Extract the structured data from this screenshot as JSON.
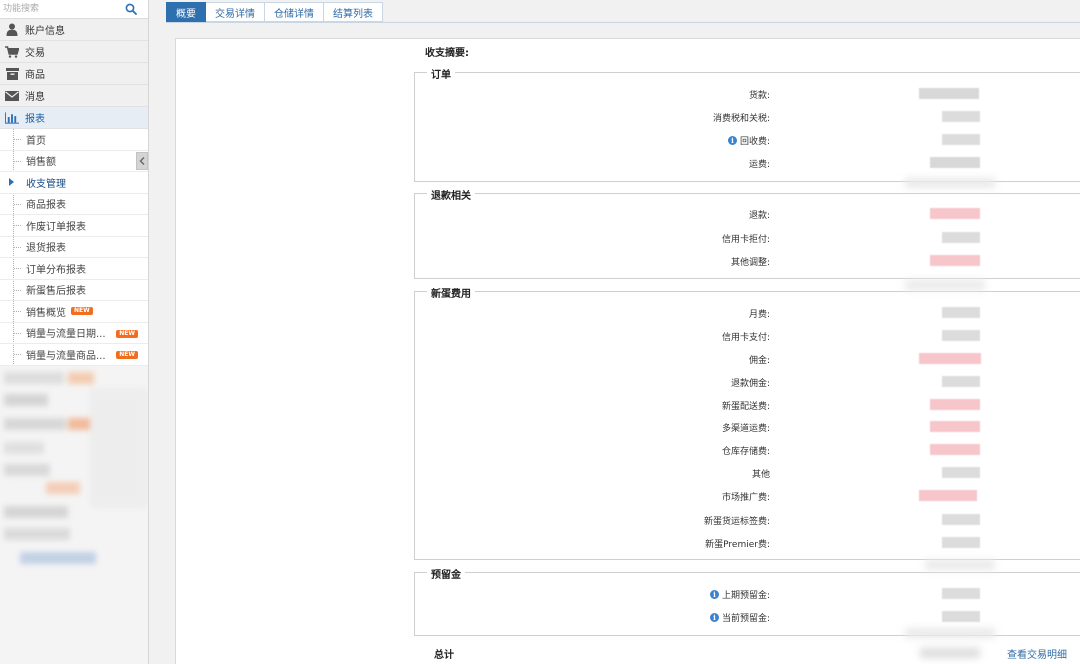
{
  "search": {
    "placeholder": "功能搜索"
  },
  "nav": {
    "main_items": [
      {
        "label": "账户信息",
        "icon": "user-icon"
      },
      {
        "label": "交易",
        "icon": "cart-icon"
      },
      {
        "label": "商品",
        "icon": "box-icon"
      },
      {
        "label": "消息",
        "icon": "envelope-icon"
      },
      {
        "label": "报表",
        "icon": "bar-chart-icon"
      }
    ],
    "report_sub_items": [
      {
        "label": "首页"
      },
      {
        "label": "销售额"
      },
      {
        "label": "收支管理"
      },
      {
        "label": "商品报表"
      },
      {
        "label": "作废订单报表"
      },
      {
        "label": "退货报表"
      },
      {
        "label": "订单分布报表"
      },
      {
        "label": "新蛋售后报表"
      },
      {
        "label": "销售概览"
      },
      {
        "label": "销量与流量日期..."
      },
      {
        "label": "销量与流量商品..."
      }
    ],
    "new_badge": "NEW"
  },
  "tabs": [
    {
      "label": "概要"
    },
    {
      "label": "交易详情"
    },
    {
      "label": "仓储详情"
    },
    {
      "label": "结算列表"
    }
  ],
  "summary": {
    "title": "收支摘要:",
    "groups": [
      {
        "legend": "订单",
        "rows": [
          {
            "label": "货款:"
          },
          {
            "label": "消费税和关税:"
          },
          {
            "label": "回收费:"
          },
          {
            "label": "运费:"
          }
        ]
      },
      {
        "legend": "退款相关",
        "rows": [
          {
            "label": "退款:"
          },
          {
            "label": "信用卡拒付:"
          },
          {
            "label": "其他调整:"
          }
        ]
      },
      {
        "legend": "新蛋费用",
        "rows": [
          {
            "label": "月费:"
          },
          {
            "label": "信用卡支付:"
          },
          {
            "label": "佣金:"
          },
          {
            "label": "退款佣金:"
          },
          {
            "label": "新蛋配送费:"
          },
          {
            "label": "多渠道运费:"
          },
          {
            "label": "仓库存储费:"
          },
          {
            "label": "其他"
          },
          {
            "label": "市场推广费:"
          },
          {
            "label": "新蛋货运标签费:"
          },
          {
            "label": "新蛋Premier费:"
          }
        ]
      },
      {
        "legend": "预留金",
        "rows": [
          {
            "label": "上期预留金:"
          },
          {
            "label": "当前预留金:"
          }
        ]
      }
    ],
    "total_label": "总计",
    "view_link": "查看交易明细"
  },
  "colors": {
    "accent": "#2e6fb0",
    "new_badge": "#f36d21",
    "info_icon": "#3b82d1"
  }
}
